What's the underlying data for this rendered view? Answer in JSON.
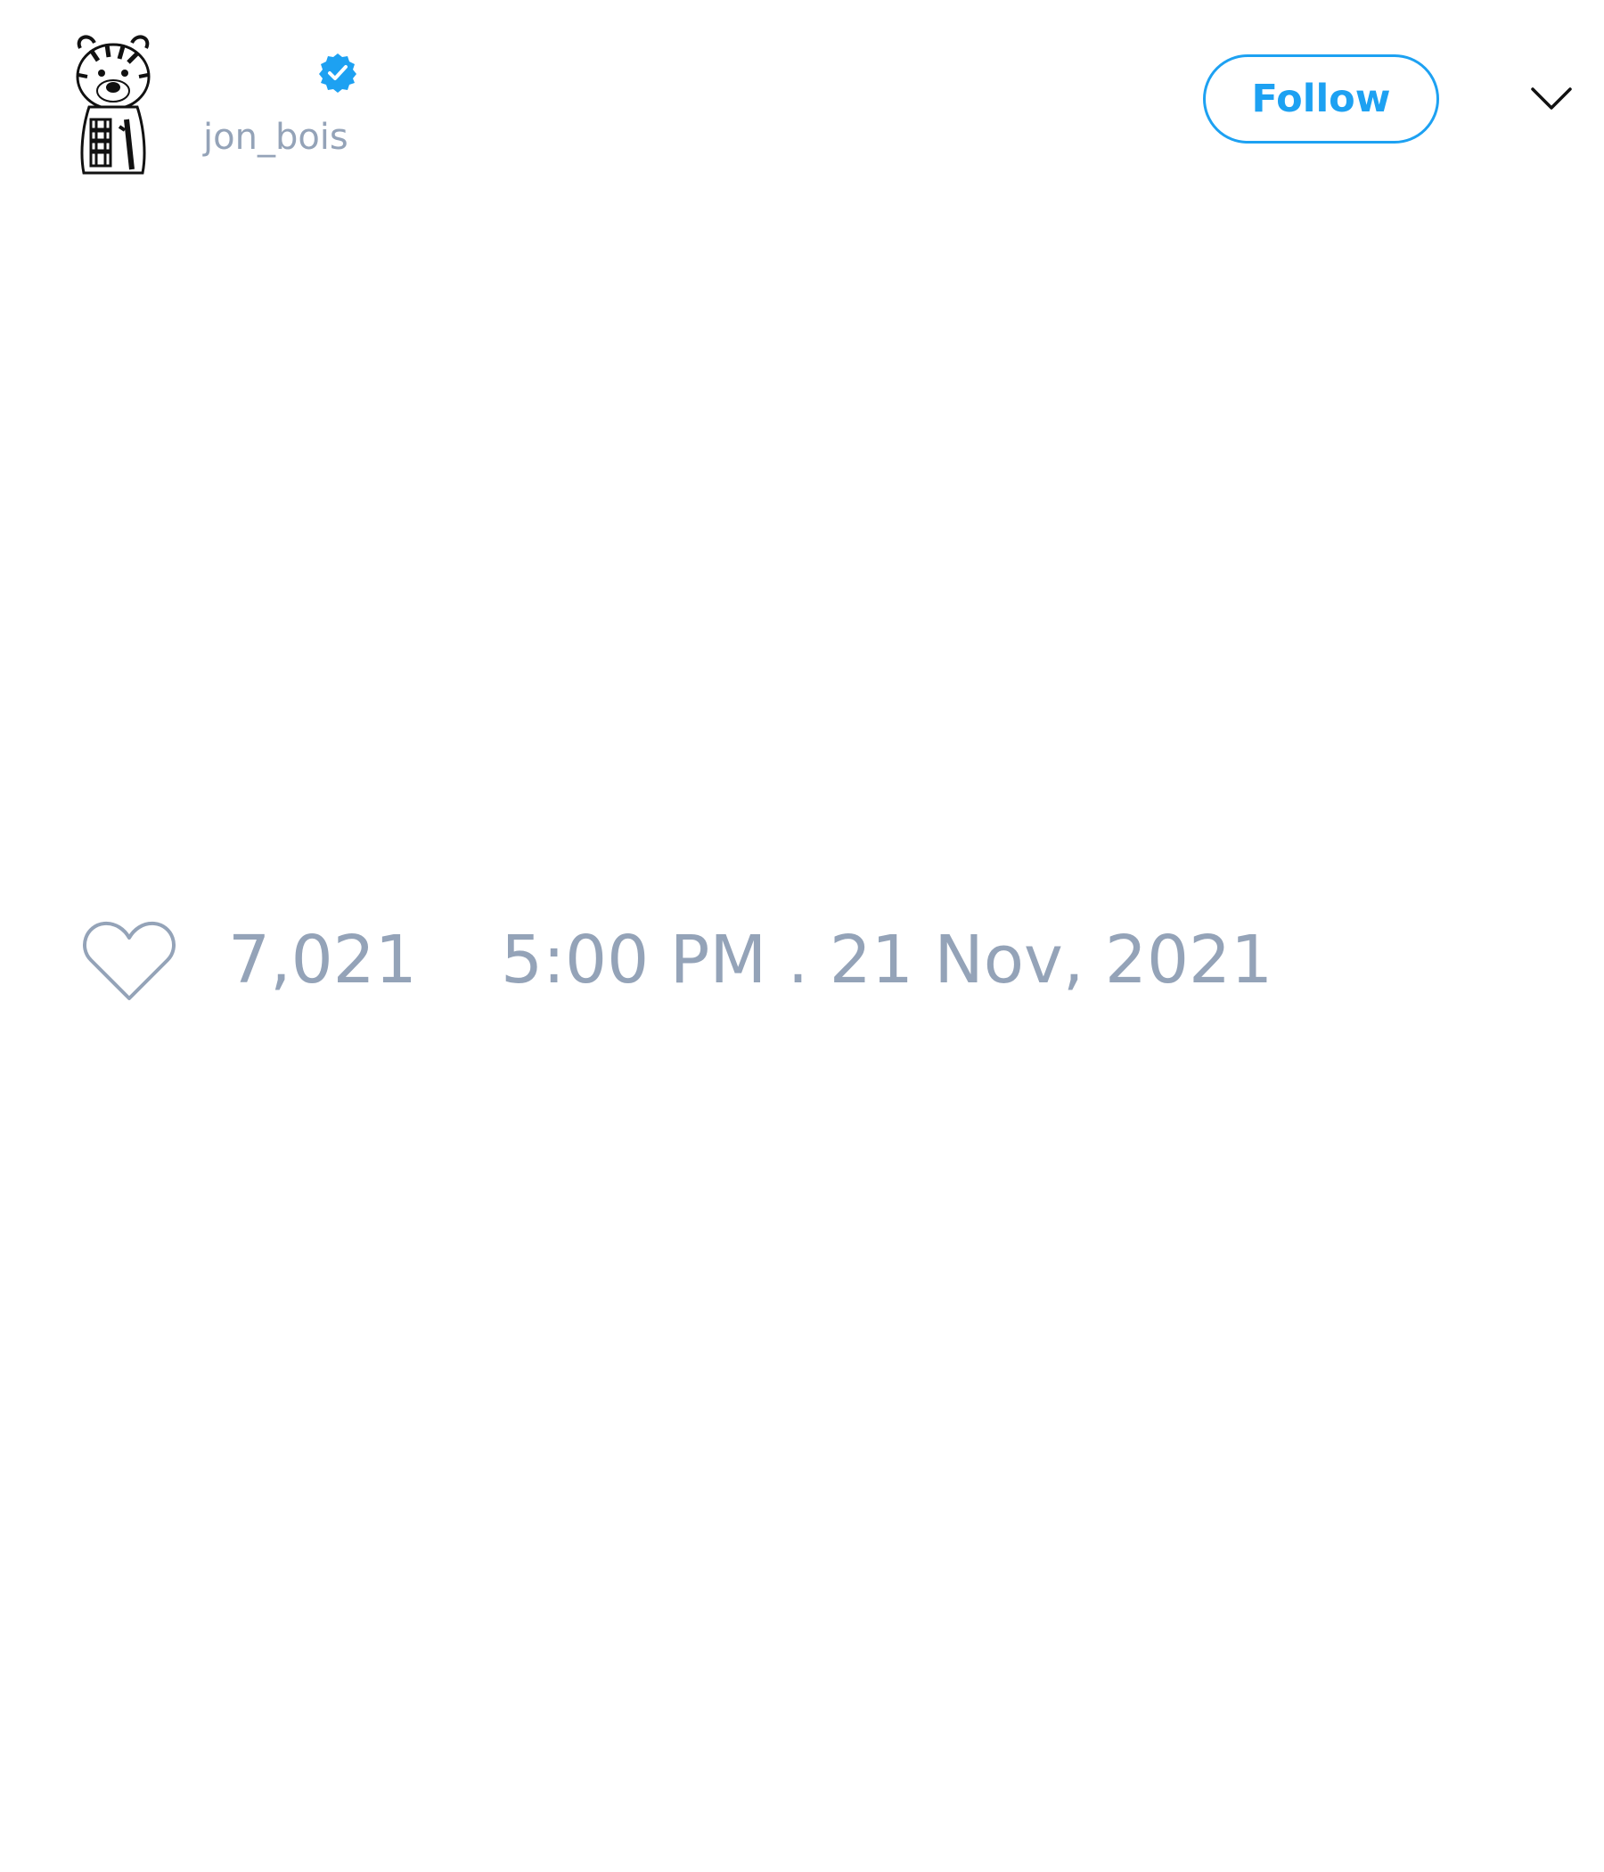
{
  "author": {
    "display_name": "",
    "handle": "jon_bois",
    "verified": true
  },
  "header": {
    "follow_label": "Follow",
    "menu_icon": "chevron-down-icon"
  },
  "tweet": {
    "like_icon": "heart-icon",
    "like_count": "7,021",
    "timestamp": "5:00 PM . 21 Nov, 2021"
  },
  "colors": {
    "accent": "#1da1f2",
    "muted_text": "#94a3b8"
  }
}
